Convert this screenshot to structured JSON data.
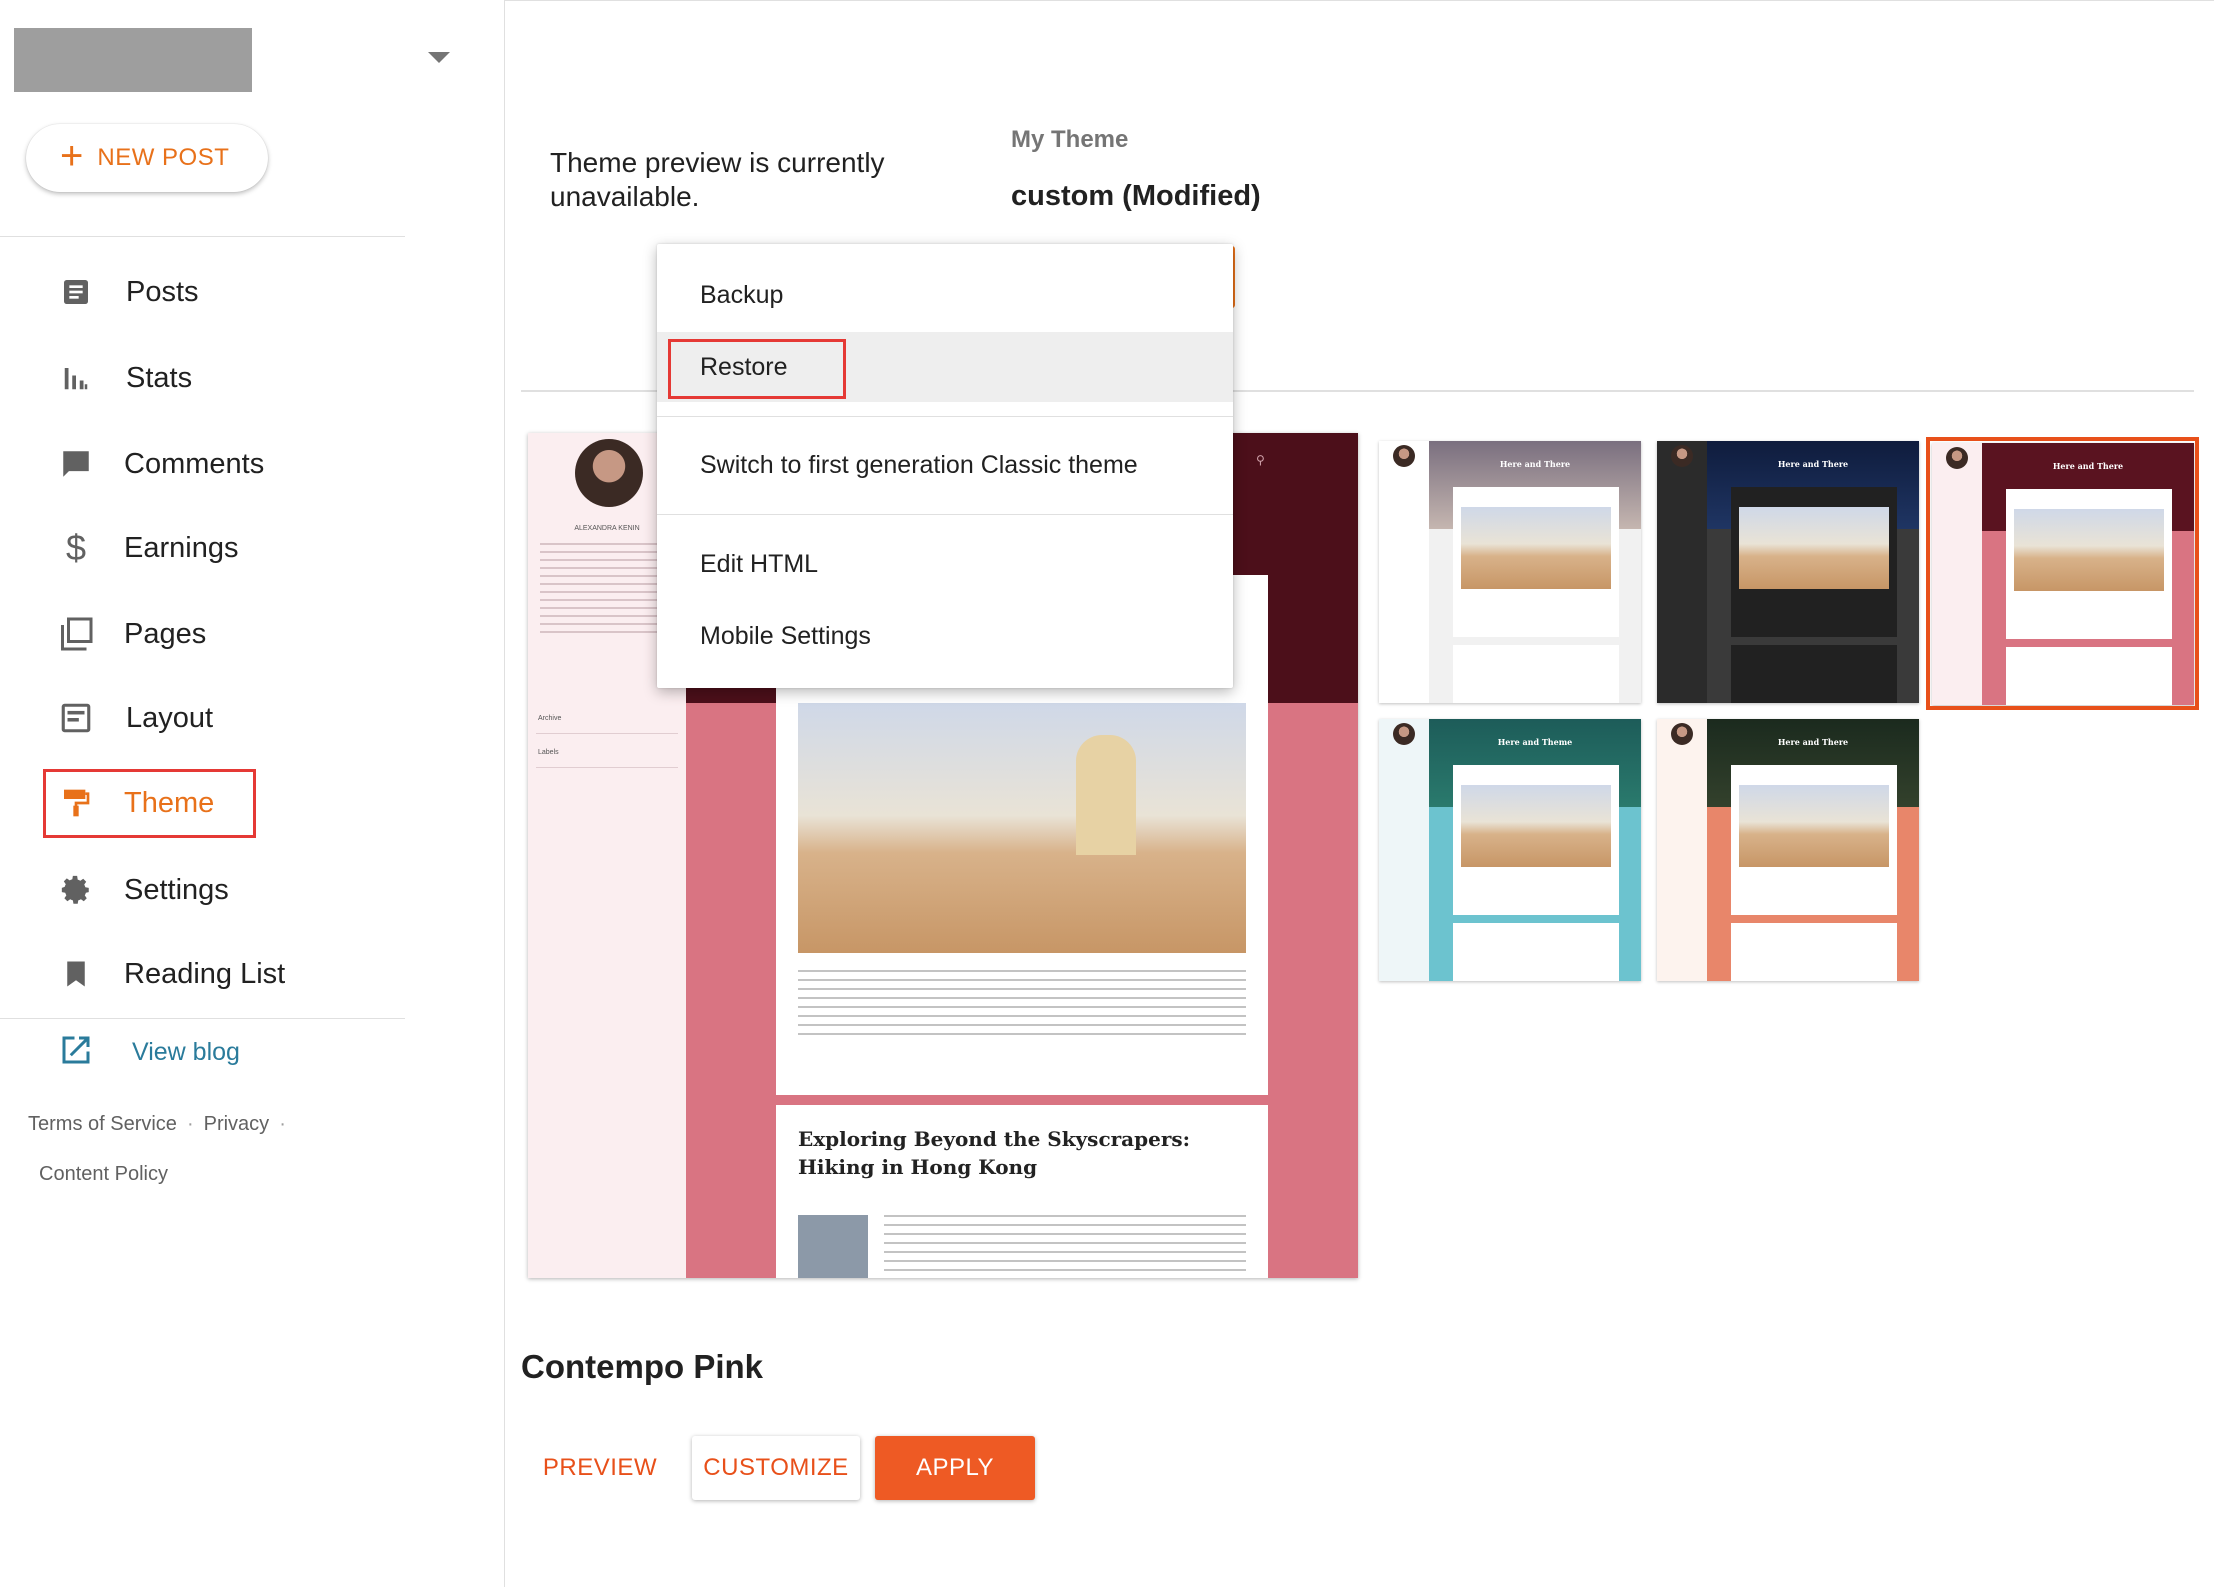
{
  "sidebar": {
    "new_post_label": "NEW POST",
    "nav": [
      {
        "label": "Posts",
        "icon": "posts-icon"
      },
      {
        "label": "Stats",
        "icon": "stats-icon"
      },
      {
        "label": "Comments",
        "icon": "comments-icon"
      },
      {
        "label": "Earnings",
        "icon": "dollar-icon"
      },
      {
        "label": "Pages",
        "icon": "pages-icon"
      },
      {
        "label": "Layout",
        "icon": "layout-icon"
      },
      {
        "label": "Theme",
        "icon": "paint-roller-icon",
        "active": true
      },
      {
        "label": "Settings",
        "icon": "gear-icon"
      },
      {
        "label": "Reading List",
        "icon": "bookmark-icon"
      }
    ],
    "view_blog_label": "View blog",
    "footer": {
      "terms": "Terms of Service",
      "privacy": "Privacy",
      "content_policy": "Content Policy"
    }
  },
  "main": {
    "preview_message": "Theme preview is currently unavailable.",
    "my_theme_label": "My Theme",
    "my_theme_name": "custom (Modified)",
    "menu": {
      "items": [
        "Backup",
        "Restore",
        "Switch to first generation Classic theme",
        "Edit HTML",
        "Mobile Settings"
      ]
    },
    "preview": {
      "profile_name": "ALEXANDRA KENIN",
      "archive_label": "Archive",
      "labels_label": "Labels",
      "post_title": "Exploring Beyond the Skyscrapers: Hiking in Hong Kong"
    },
    "thumbnails": [
      {
        "title": "Here and There"
      },
      {
        "title": "Here and There"
      },
      {
        "title": "Here and There"
      },
      {
        "title": "Here and Theme"
      },
      {
        "title": "Here and There"
      }
    ],
    "theme_title": "Contempo Pink",
    "buttons": {
      "preview": "PREVIEW",
      "customize": "CUSTOMIZE",
      "apply": "APPLY"
    }
  },
  "colors": {
    "accent": "#e8711a",
    "apply_button": "#ee5a24",
    "highlight_box": "#e53935"
  }
}
